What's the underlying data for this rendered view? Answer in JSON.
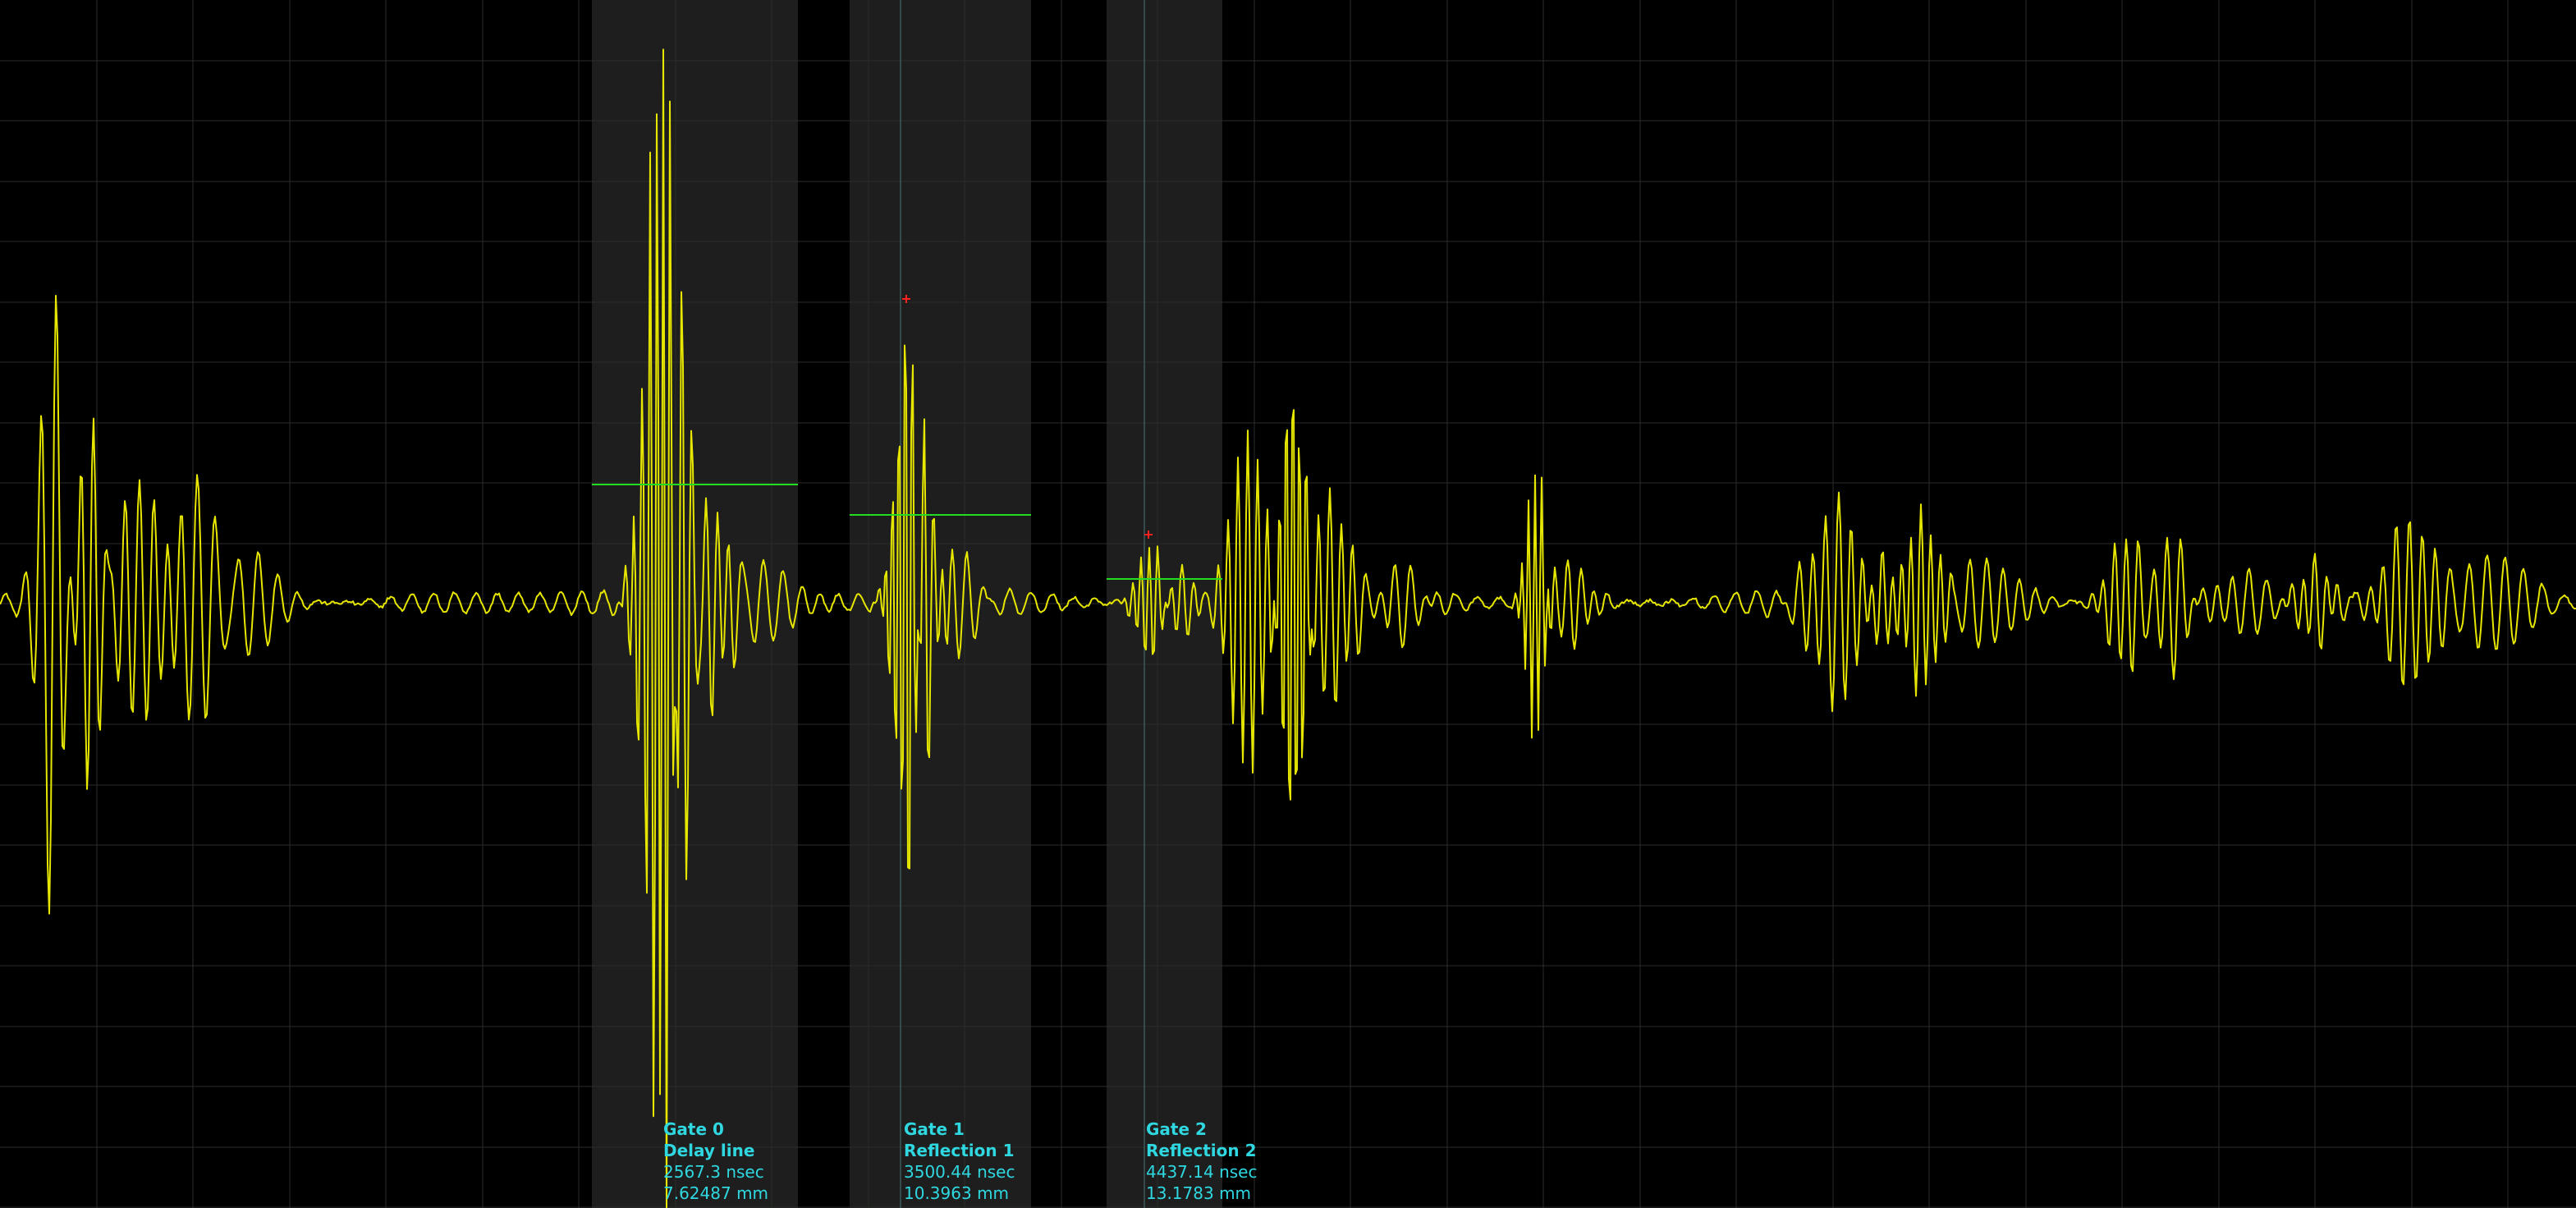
{
  "colors": {
    "background": "#000000",
    "grid": "#2a2d2a",
    "gate_region": "#1e1e1e",
    "trace": "#e6e600",
    "threshold": "#22dd22",
    "marker": "#ff2020",
    "label": "#2fd8e0"
  },
  "gates": [
    {
      "title": "Gate 0",
      "name": "Delay line",
      "time": "2567.3 nsec",
      "distance": "7.62487 mm"
    },
    {
      "title": "Gate 1",
      "name": "Reflection 1",
      "time": "3500.44 nsec",
      "distance": "10.3963 mm"
    },
    {
      "title": "Gate 2",
      "name": "Reflection 2",
      "time": "4437.14 nsec",
      "distance": "13.1783 mm"
    }
  ]
}
